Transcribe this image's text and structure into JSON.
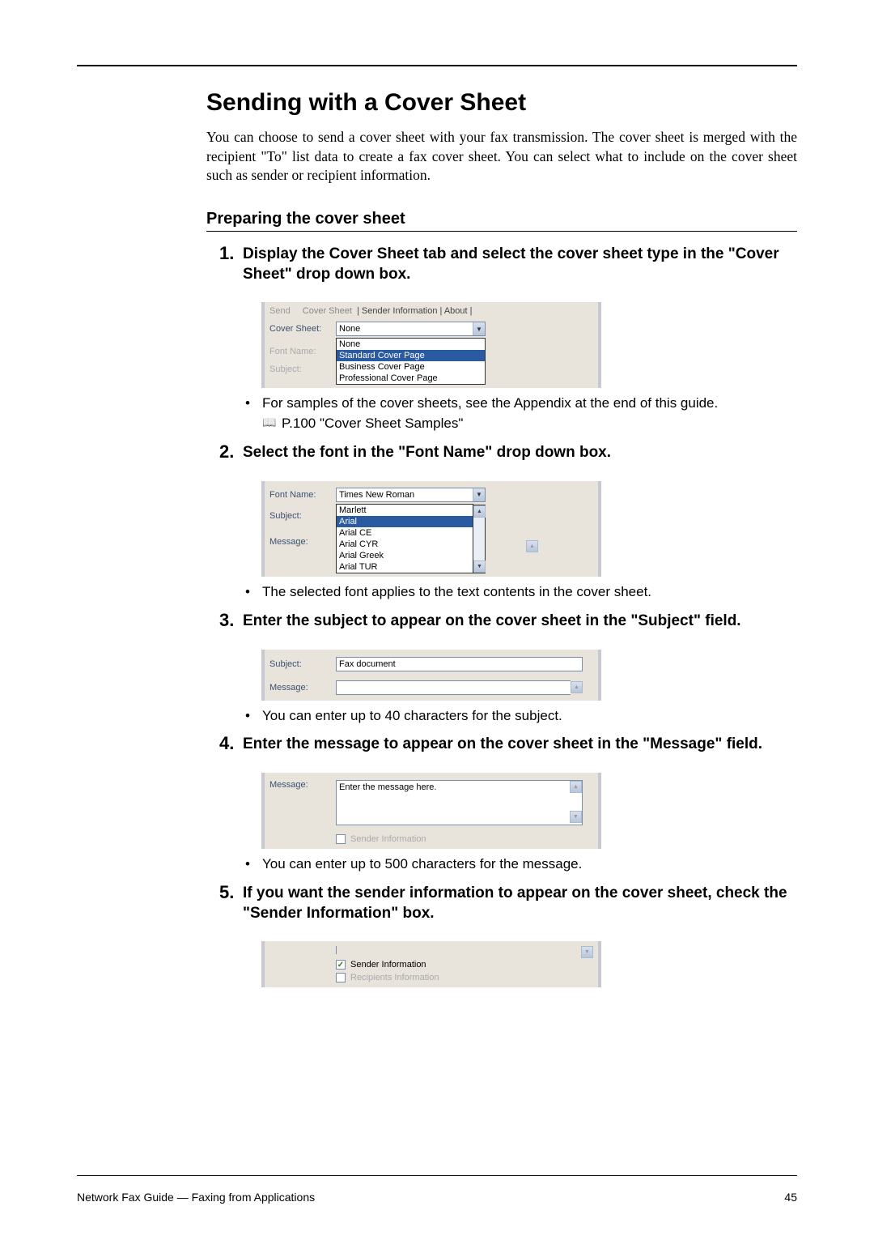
{
  "heading": "Sending with a Cover Sheet",
  "intro": "You can choose to send a cover sheet with your fax transmission. The cover sheet is merged with the recipient \"To\" list data to create a fax cover sheet. You can select what to include on the cover sheet such as sender or recipient information.",
  "subheading": "Preparing the cover sheet",
  "steps": {
    "s1": {
      "num": "1.",
      "text": "Display the Cover Sheet tab and select the cover sheet type in the \"Cover Sheet\" drop down box.",
      "bullet": "For samples of the cover sheets, see the Appendix at the end of this guide.",
      "ref": "P.100 \"Cover Sheet Samples\""
    },
    "s2": {
      "num": "2.",
      "text": "Select the font in the \"Font Name\" drop down box.",
      "bullet": "The selected font applies to the text contents in the cover sheet."
    },
    "s3": {
      "num": "3.",
      "text": "Enter the subject to appear on the cover sheet in the \"Subject\" field.",
      "bullet": "You can enter up to 40 characters for the subject."
    },
    "s4": {
      "num": "4.",
      "text": "Enter the message to appear on the cover sheet in the \"Message\" field.",
      "bullet": "You can enter up to 500 characters for the message."
    },
    "s5": {
      "num": "5.",
      "text": "If you want the sender information to appear on the cover sheet, check the \"Sender Information\" box."
    }
  },
  "shot1": {
    "tab_send": "Send",
    "tab_cover": "Cover Sheet",
    "tab_other": "| Sender Information | About |",
    "label_cover": "Cover Sheet:",
    "value_cover": "None",
    "label_font": "Font Name:",
    "label_subject": "Subject:",
    "dd": {
      "i0": "None",
      "i1": "Standard Cover Page",
      "i2": "Business Cover Page",
      "i3": "Professional Cover Page"
    }
  },
  "shot2": {
    "label_font": "Font Name:",
    "value_font": "Times New Roman",
    "label_subject": "Subject:",
    "label_message": "Message:",
    "dd": {
      "i0": "Marlett",
      "i1": "Arial",
      "i2": "Arial CE",
      "i3": "Arial CYR",
      "i4": "Arial Greek",
      "i5": "Arial TUR"
    }
  },
  "shot3": {
    "label_subject": "Subject:",
    "value_subject": "Fax document",
    "label_message": "Message:"
  },
  "shot4": {
    "label_message": "Message:",
    "value_message": "Enter the message here.",
    "check_sender": "Sender Information"
  },
  "shot5": {
    "check_sender": "Sender Information",
    "check_recip": "Recipients Information"
  },
  "footer": {
    "left": "Network Fax Guide — Faxing from Applications",
    "right": "45"
  }
}
